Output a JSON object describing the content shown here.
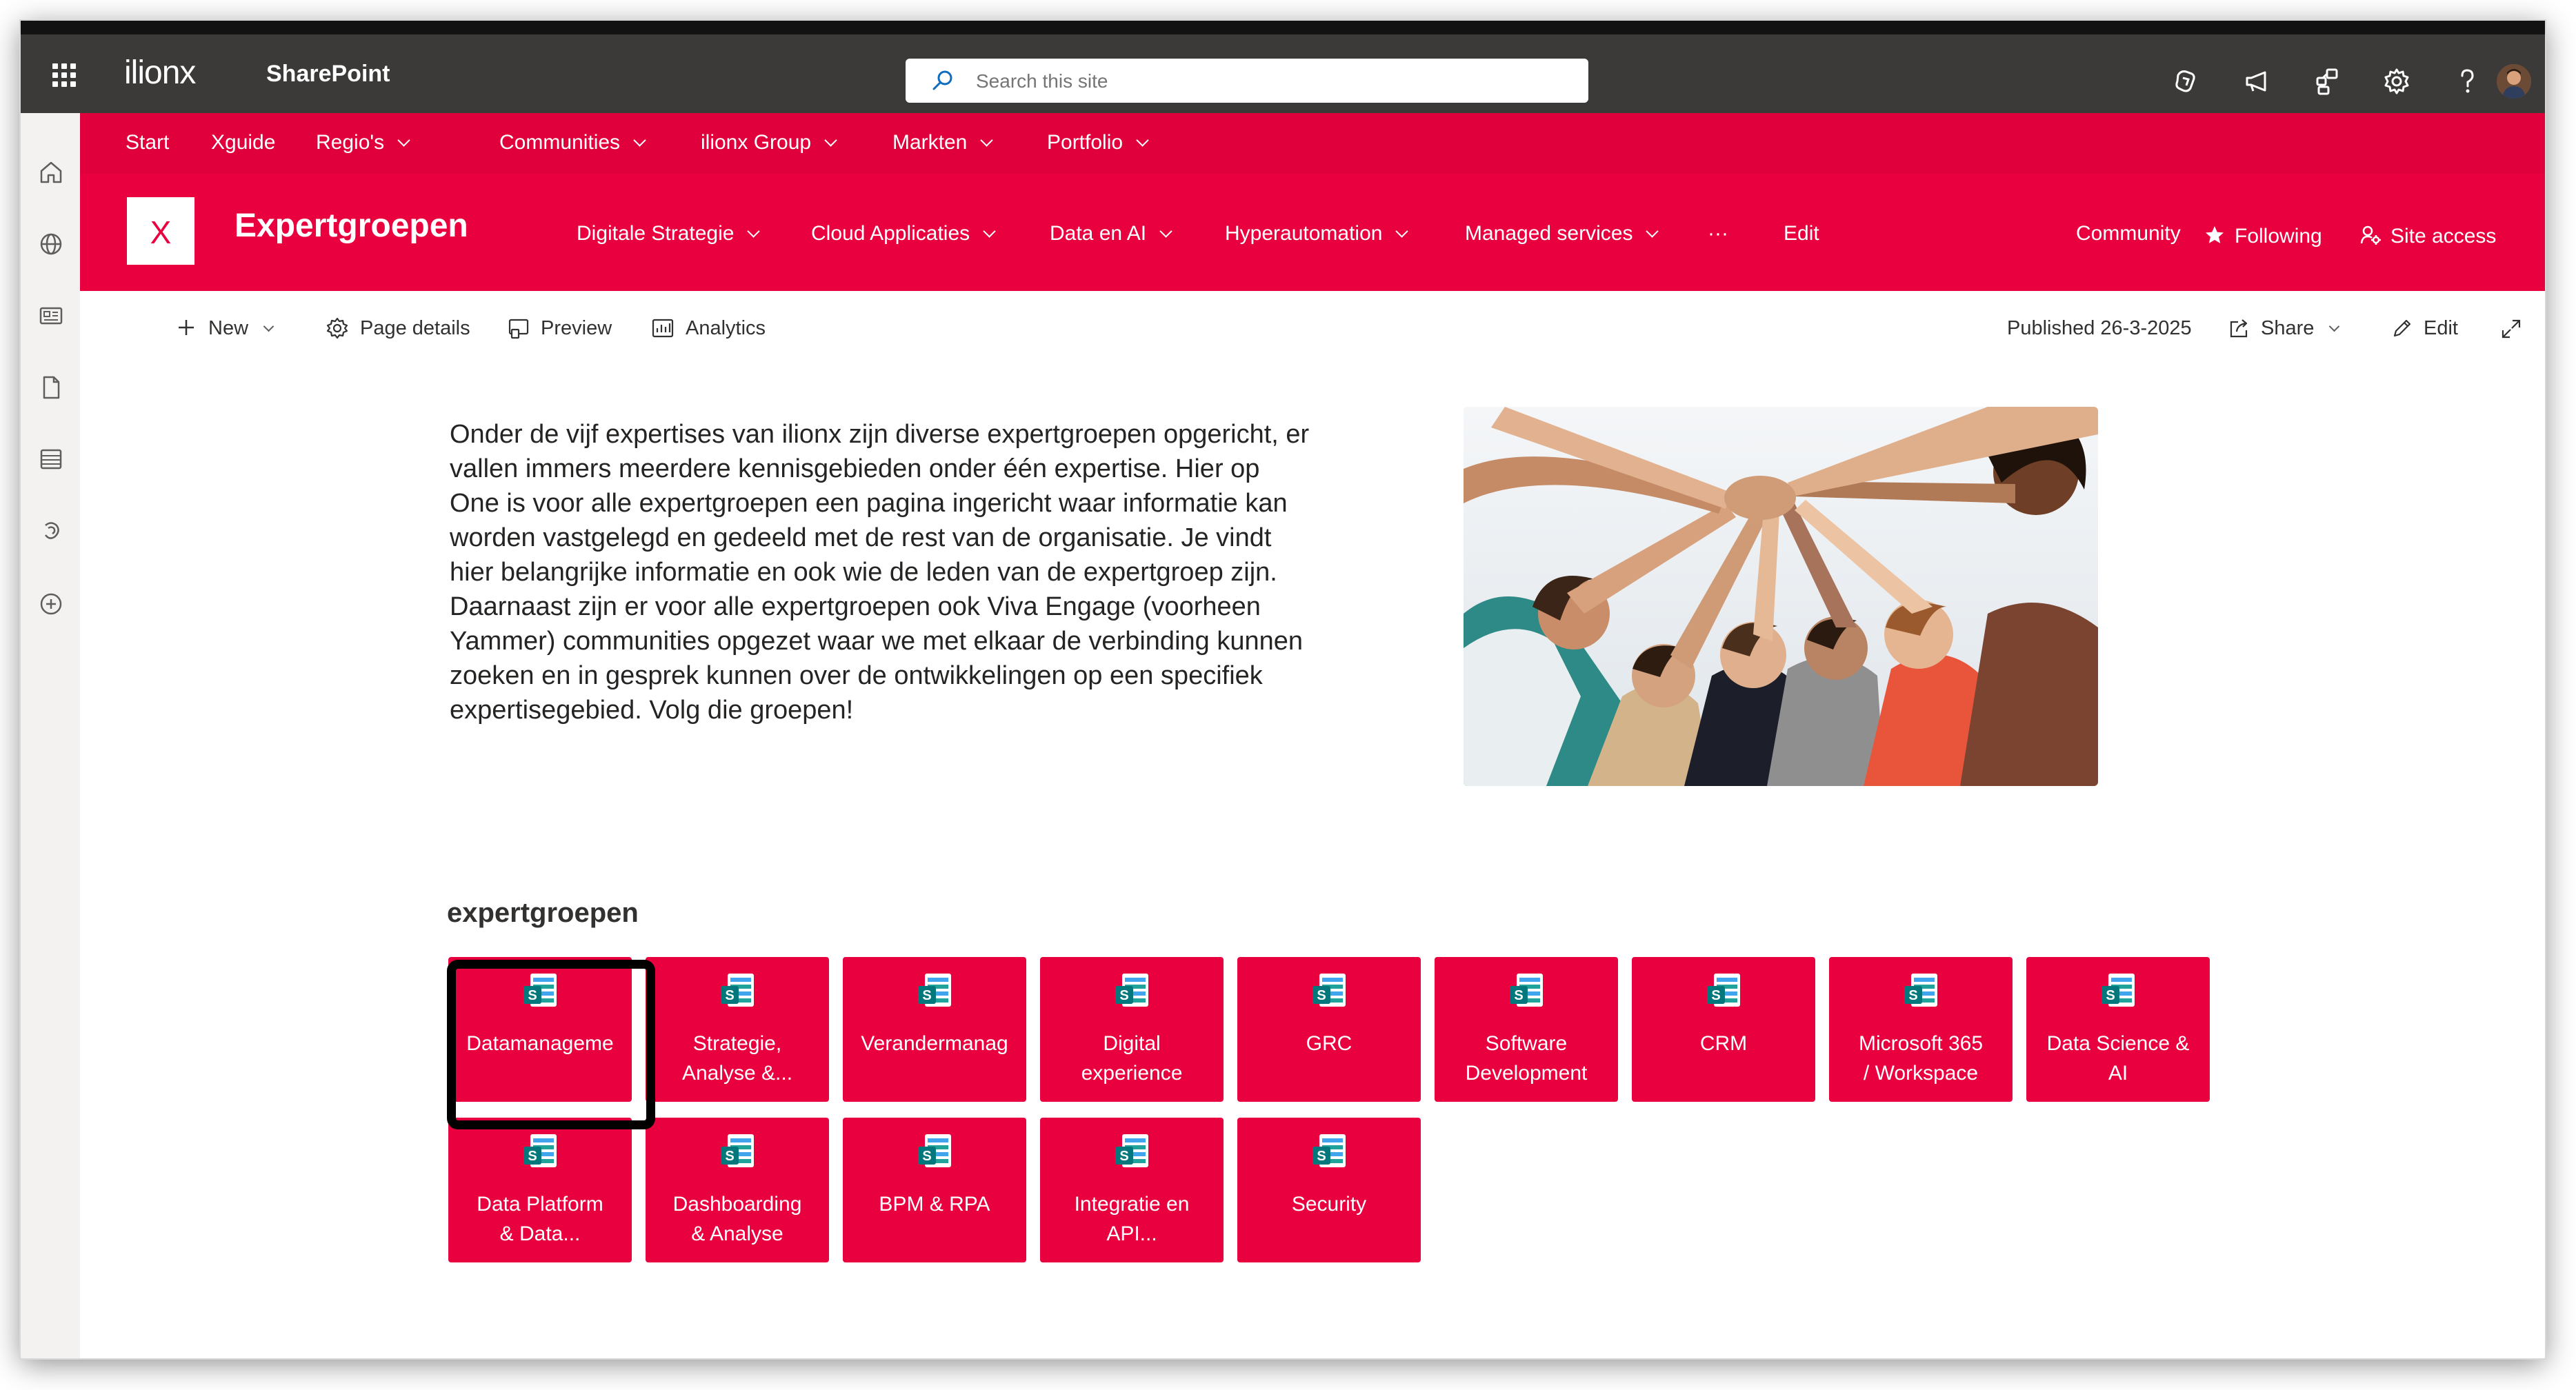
{
  "topbar": {
    "org_name": "ilionx",
    "app_name": "SharePoint",
    "search_placeholder": "Search this site",
    "icons": [
      "copilot-icon",
      "megaphone-icon",
      "network-icon",
      "settings-icon",
      "help-icon"
    ]
  },
  "left_rail": {
    "icons": [
      "home-icon",
      "globe-icon",
      "news-icon",
      "document-icon",
      "list-icon",
      "stream-icon",
      "create-icon"
    ]
  },
  "hub_nav": {
    "items": [
      {
        "label": "Start",
        "has_dropdown": false
      },
      {
        "label": "Xguide",
        "has_dropdown": false
      },
      {
        "label": "Regio's",
        "has_dropdown": true
      },
      {
        "label": "Communities",
        "has_dropdown": true
      },
      {
        "label": "ilionx Group",
        "has_dropdown": true
      },
      {
        "label": "Markten",
        "has_dropdown": true
      },
      {
        "label": "Portfolio",
        "has_dropdown": true
      }
    ]
  },
  "site_header": {
    "logo_letter": "X",
    "title": "Expertgroepen",
    "nav": [
      {
        "label": "Digitale Strategie",
        "has_dropdown": true
      },
      {
        "label": "Cloud Applicaties",
        "has_dropdown": true
      },
      {
        "label": "Data en AI",
        "has_dropdown": true
      },
      {
        "label": "Hyperautomation",
        "has_dropdown": true
      },
      {
        "label": "Managed services",
        "has_dropdown": true
      },
      {
        "label": "···",
        "has_dropdown": false
      },
      {
        "label": "Edit",
        "has_dropdown": false
      }
    ],
    "community_label": "Community",
    "following_label": "Following",
    "site_access_label": "Site access"
  },
  "command_bar": {
    "new_label": "New",
    "page_details_label": "Page details",
    "preview_label": "Preview",
    "analytics_label": "Analytics",
    "published_label": "Published 26-3-2025",
    "share_label": "Share",
    "edit_label": "Edit"
  },
  "content": {
    "intro_text": "Onder de vijf expertises van ilionx zijn diverse expertgroepen opgericht, er vallen immers meerdere kennisgebieden onder één expertise. Hier op One is voor alle expertgroepen een pagina ingericht waar informatie kan worden vastgelegd en gedeeld met de rest van de organisatie. Je vindt hier belangrijke informatie en ook wie de leden van de expertgroep zijn. Daarnaast zijn er voor alle expertgroepen ook Viva Engage (voorheen Yammer) communities opgezet waar we met elkaar de verbinding kunnen zoeken en in gesprek kunnen over de ontwikkelingen op een specifiek expertisegebied. Volg die groepen!",
    "section_title": "expertgroepen",
    "tiles": [
      {
        "label": "Datamanageme",
        "selected": true
      },
      {
        "label": "Strategie,\nAnalyse &...",
        "selected": false
      },
      {
        "label": "Verandermanag",
        "selected": false
      },
      {
        "label": "Digital\nexperience",
        "selected": false
      },
      {
        "label": "GRC",
        "selected": false
      },
      {
        "label": "Software\nDevelopment",
        "selected": false
      },
      {
        "label": "CRM",
        "selected": false
      },
      {
        "label": "Microsoft 365\n/ Workspace",
        "selected": false
      },
      {
        "label": "Data Science &\nAI",
        "selected": false
      },
      {
        "label": "Data Platform\n& Data...",
        "selected": false
      },
      {
        "label": "Dashboarding\n& Analyse",
        "selected": false
      },
      {
        "label": "BPM & RPA",
        "selected": false
      },
      {
        "label": "Integratie en\nAPI...",
        "selected": false
      },
      {
        "label": "Security",
        "selected": false
      }
    ],
    "tile_icon": "sharepoint-site-icon",
    "hero_image": "team-hands-together-photo"
  },
  "colors": {
    "brand": "#e8003f",
    "hub_nav": "#e0003c",
    "suite_bar": "#3b3a39",
    "rail": "#f3f2f1",
    "text": "#252423"
  }
}
